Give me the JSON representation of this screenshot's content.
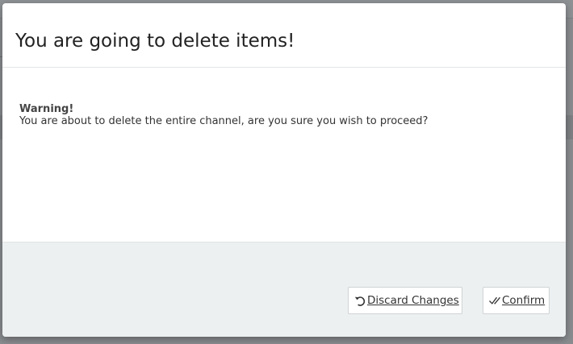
{
  "dialog": {
    "title": "You are going to delete items!",
    "warning_title": "Warning!",
    "warning_text": "You are about to delete the entire channel, are you sure you wish to proceed?"
  },
  "footer": {
    "discard_label": "Discard Changes",
    "discard_icon": "undo-icon",
    "confirm_label": "Confirm",
    "confirm_icon": "double-check-icon"
  }
}
